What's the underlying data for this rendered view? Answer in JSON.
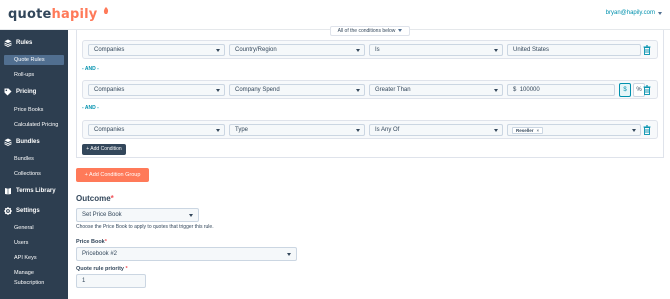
{
  "brand": {
    "logo_main": "quote",
    "logo_accent": "hapily",
    "accent_color": "#ff7a59",
    "sidebar_color": "#2d3e50"
  },
  "user": {
    "email": "bryan@hapily.com"
  },
  "sidebar": {
    "sections": [
      {
        "label": "Rules",
        "icon": "stack-icon",
        "items": [
          {
            "label": "Quote Rules",
            "active": true
          },
          {
            "label": "Roll-ups",
            "active": false
          }
        ]
      },
      {
        "label": "Pricing",
        "icon": "tag-icon",
        "items": [
          {
            "label": "Price Books",
            "active": false
          },
          {
            "label": "Calculated Pricing",
            "active": false
          }
        ]
      },
      {
        "label": "Bundles",
        "icon": "stack-icon",
        "items": [
          {
            "label": "Bundles",
            "active": false
          },
          {
            "label": "Collections",
            "active": false
          }
        ]
      },
      {
        "label": "Terms Library",
        "icon": "book-icon",
        "items": []
      },
      {
        "label": "Settings",
        "icon": "gear-icon",
        "items": [
          {
            "label": "General",
            "active": false
          },
          {
            "label": "Users",
            "active": false
          },
          {
            "label": "API Keys",
            "active": false
          },
          {
            "label": "Manage Subscription",
            "active": false
          }
        ]
      }
    ]
  },
  "conditions": {
    "match_mode": "All of the conditions below",
    "and_label": "- AND -",
    "rows": [
      {
        "object": "Companies",
        "property": "Country/Region",
        "operator": "Is",
        "value": "United States"
      },
      {
        "object": "Companies",
        "property": "Company Spend",
        "operator": "Greater Than",
        "currency": "$",
        "value": "100000",
        "unit_dollar": "$",
        "unit_percent": "%"
      },
      {
        "object": "Companies",
        "property": "Type",
        "operator": "Is Any Of",
        "chip": "Reseller",
        "chip_remove": "×"
      }
    ],
    "add_condition_label": "+ Add Condition",
    "add_group_label": "+ Add Condition Group"
  },
  "outcome": {
    "heading": "Outcome",
    "required_mark": "*",
    "action": "Set Price Book",
    "help_text": "Choose the Price Book to apply to quotes that trigger this rule.",
    "price_book_label": "Price Book",
    "price_book_value": "Pricebook #2",
    "priority_label": "Quote rule priority",
    "priority_value": "1"
  }
}
